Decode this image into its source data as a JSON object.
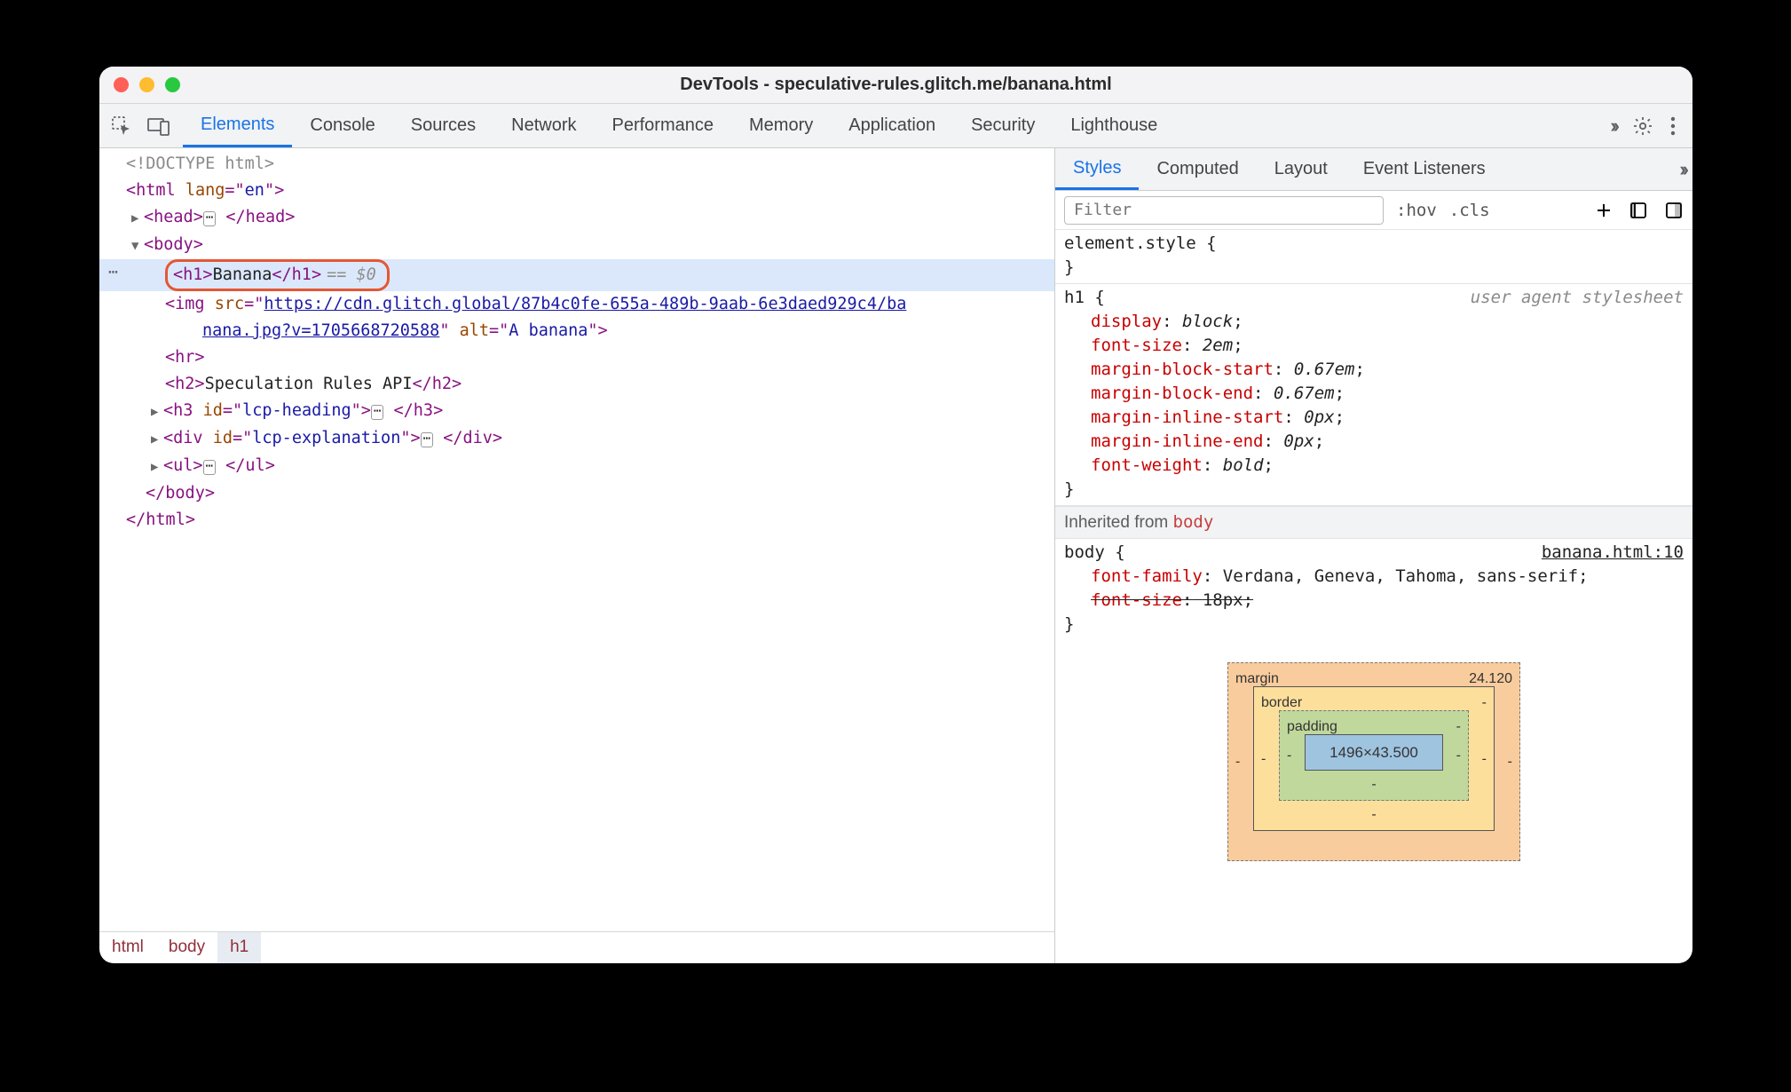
{
  "window": {
    "title": "DevTools - speculative-rules.glitch.me/banana.html"
  },
  "main_tabs": [
    "Elements",
    "Console",
    "Sources",
    "Network",
    "Performance",
    "Memory",
    "Application",
    "Security",
    "Lighthouse"
  ],
  "main_tab_active": "Elements",
  "dom": {
    "doctype": "<!DOCTYPE html>",
    "html_open": {
      "tag": "html",
      "attr_name": "lang",
      "attr_val": "en"
    },
    "head": {
      "open": "<head>",
      "close": "</head>"
    },
    "body_open": "<body>",
    "h1": {
      "open": "<h1>",
      "text": "Banana",
      "close": "</h1>",
      "eq0": "== $0"
    },
    "img": {
      "open": "<img",
      "src_name": "src",
      "src_p1": "https://cdn.glitch.global/87b4c0fe-655a-489b-9aab-6e3daed929c4/ba",
      "src_p2": "nana.jpg?v=1705668720588",
      "alt_name": "alt",
      "alt_val": "A banana",
      "close": ">"
    },
    "hr": "<hr>",
    "h2": {
      "open": "<h2>",
      "text": "Speculation Rules API",
      "close": "</h2>"
    },
    "h3": {
      "open": "<h3 ",
      "id_name": "id",
      "id_val": "lcp-heading",
      "close_open": ">",
      "close": "</h3>"
    },
    "div": {
      "open": "<div ",
      "id_name": "id",
      "id_val": "lcp-explanation",
      "close_open": ">",
      "close": "</div>"
    },
    "ul": {
      "open": "<ul>",
      "close": "</ul>"
    },
    "body_close": "</body>",
    "html_close": "</html>"
  },
  "breadcrumbs": [
    "html",
    "body",
    "h1"
  ],
  "breadcrumb_active": "h1",
  "sub_tabs": [
    "Styles",
    "Computed",
    "Layout",
    "Event Listeners"
  ],
  "sub_tab_active": "Styles",
  "styles_toolbar": {
    "filter_placeholder": "Filter",
    "hov": ":hov",
    "cls": ".cls"
  },
  "styles": {
    "element_style": {
      "selector": "element.style",
      "open": " {",
      "close": "}"
    },
    "h1_rule": {
      "selector": "h1",
      "open": " {",
      "ua": "user agent stylesheet",
      "props": [
        {
          "name": "display",
          "value": "block"
        },
        {
          "name": "font-size",
          "value": "2em"
        },
        {
          "name": "margin-block-start",
          "value": "0.67em"
        },
        {
          "name": "margin-block-end",
          "value": "0.67em"
        },
        {
          "name": "margin-inline-start",
          "value": "0px"
        },
        {
          "name": "margin-inline-end",
          "value": "0px"
        },
        {
          "name": "font-weight",
          "value": "bold"
        }
      ],
      "close": "}"
    },
    "inherited_label": "Inherited from ",
    "inherited_sel": "body",
    "body_rule": {
      "selector": "body",
      "open": " {",
      "source": "banana.html:10",
      "props": [
        {
          "name": "font-family",
          "value": "Verdana, Geneva, Tahoma, sans-serif",
          "strike": false
        },
        {
          "name": "font-size",
          "value": "18px",
          "strike": true
        }
      ],
      "close": "}"
    }
  },
  "box_model": {
    "margin_label": "margin",
    "margin_top": "24.120",
    "border_label": "border",
    "padding_label": "padding",
    "content": "1496×43.500",
    "dash": "-"
  }
}
